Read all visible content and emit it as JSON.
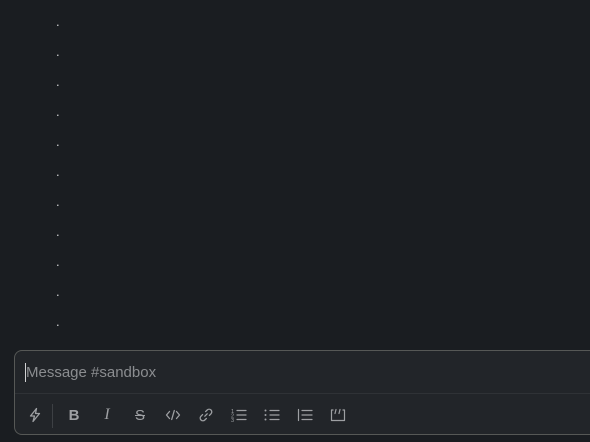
{
  "channel": {
    "name": "sandbox"
  },
  "messages": [
    {
      "text": "."
    },
    {
      "text": "."
    },
    {
      "text": "."
    },
    {
      "text": "."
    },
    {
      "text": "."
    },
    {
      "text": "."
    },
    {
      "text": "."
    },
    {
      "text": "."
    },
    {
      "text": "."
    },
    {
      "text": "."
    },
    {
      "text": "."
    }
  ],
  "composer": {
    "placeholder": "Message #sandbox",
    "value": ""
  },
  "toolbar": {
    "shortcuts_icon": "lightning-icon",
    "bold_label": "B",
    "italic_label": "I",
    "strike_label": "S",
    "code_icon": "code-icon",
    "link_icon": "link-icon",
    "ordered_list_icon": "ordered-list-icon",
    "bulleted_list_icon": "bulleted-list-icon",
    "blockquote_icon": "blockquote-icon",
    "code_block_icon": "code-block-icon"
  },
  "colors": {
    "background": "#1a1d21",
    "composer_bg": "#222529",
    "text": "#d1d2d3",
    "icon": "#9ea0a3",
    "placeholder": "#8b8d90"
  }
}
